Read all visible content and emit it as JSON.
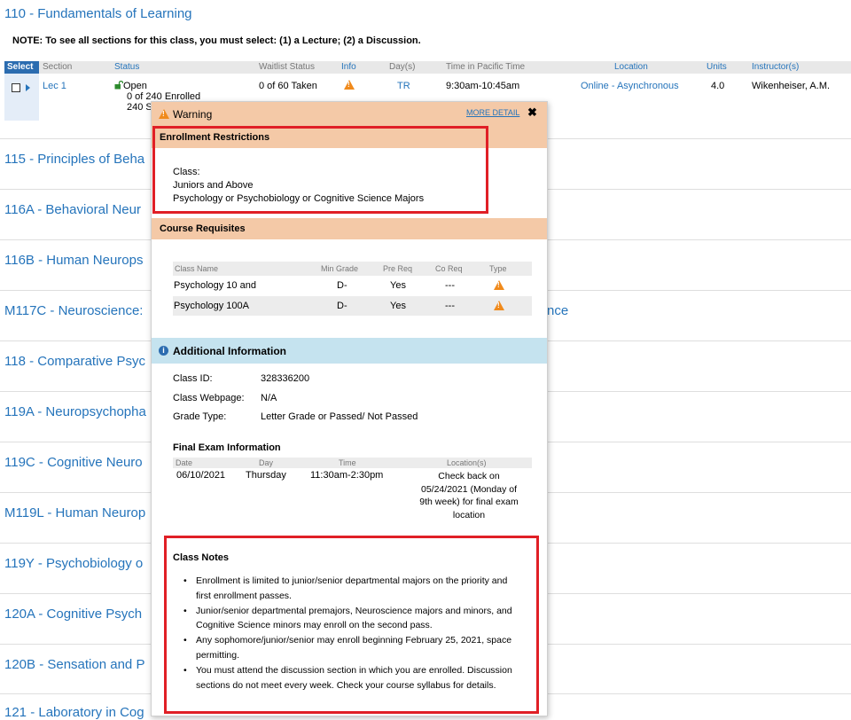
{
  "main": {
    "title": "110 - Fundamentals of Learning",
    "note": "NOTE: To see all sections for this class, you must select: (1) a Lecture; (2) a Discussion."
  },
  "table": {
    "headers": {
      "select": "Select",
      "section": "Section",
      "status": "Status",
      "waitlist": "Waitlist Status",
      "info": "Info",
      "days": "Day(s)",
      "time": "Time in Pacific Time",
      "location": "Location",
      "units": "Units",
      "instructor": "Instructor(s)"
    },
    "row": {
      "section": "Lec 1",
      "status": "Open",
      "enrolled": "0 of 240 Enrolled",
      "seats": "240 S",
      "waitlist": "0 of 60 Taken",
      "days": "TR",
      "time": "9:30am-10:45am",
      "location": "Online - Asynchronous",
      "units": "4.0",
      "instructor": "Wikenheiser, A.M."
    }
  },
  "courses": [
    {
      "label": "115 - Principles of Beha"
    },
    {
      "label": "116A - Behavioral Neur"
    },
    {
      "label": "116B - Human Neurops"
    },
    {
      "label": "M117C - Neuroscience:",
      "tail": "nce"
    },
    {
      "label": "118 - Comparative Psyc"
    },
    {
      "label": "119A - Neuropsychopha"
    },
    {
      "label": "119C - Cognitive Neuro"
    },
    {
      "label": "M119L - Human Neurop"
    },
    {
      "label": "119Y - Psychobiology o"
    },
    {
      "label": "120A - Cognitive Psych"
    },
    {
      "label": "120B - Sensation and P"
    },
    {
      "label": "121 - Laboratory in Cog"
    }
  ],
  "popup": {
    "warning_title": "Warning",
    "more_detail": "MORE DETAIL",
    "close": "✖",
    "enrollment_restrictions": {
      "title": "Enrollment Restrictions",
      "lines": [
        "Class:",
        "Juniors and Above",
        "Psychology or Psychobiology or Cognitive Science Majors"
      ]
    },
    "course_requisites": {
      "title": "Course Requisites",
      "headers": {
        "class_name": "Class Name",
        "min_grade": "Min Grade",
        "pre_req": "Pre Req",
        "co_req": "Co Req",
        "type": "Type"
      },
      "rows": [
        {
          "class_name": "Psychology 10 and",
          "min_grade": "D-",
          "pre_req": "Yes",
          "co_req": "---"
        },
        {
          "class_name": "Psychology 100A",
          "min_grade": "D-",
          "pre_req": "Yes",
          "co_req": "---"
        }
      ]
    },
    "additional_information": {
      "title": "Additional Information",
      "class_id_label": "Class ID:",
      "class_id": "328336200",
      "webpage_label": "Class Webpage:",
      "webpage": "N/A",
      "grade_type_label": "Grade Type:",
      "grade_type": "Letter Grade or Passed/ Not Passed"
    },
    "final_exam": {
      "title": "Final Exam Information",
      "headers": {
        "date": "Date",
        "day": "Day",
        "time": "Time",
        "location": "Location(s)"
      },
      "date": "06/10/2021",
      "day": "Thursday",
      "time": "11:30am-2:30pm",
      "location_lines": [
        "Check back on",
        "05/24/2021 (Monday of",
        "9th week) for final exam",
        "location"
      ]
    },
    "class_notes": {
      "title": "Class Notes",
      "items": [
        "Enrollment is limited to junior/senior departmental majors on the priority and first enrollment passes.",
        "Junior/senior departmental premajors, Neuroscience majors and minors, and Cognitive Science minors may enroll on the second pass.",
        "Any sophomore/junior/senior may enroll beginning February 25, 2021, space permitting.",
        "You must attend the discussion section in which you are enrolled. Discussion sections do not meet every week. Check your course syllabus for details."
      ]
    }
  },
  "colors": {
    "link": "#2574bb",
    "warning_bar": "#f4c9a7",
    "info_bar": "#c5e3ef",
    "highlight": "#e01f26",
    "warning_icon": "#f08a1c"
  }
}
